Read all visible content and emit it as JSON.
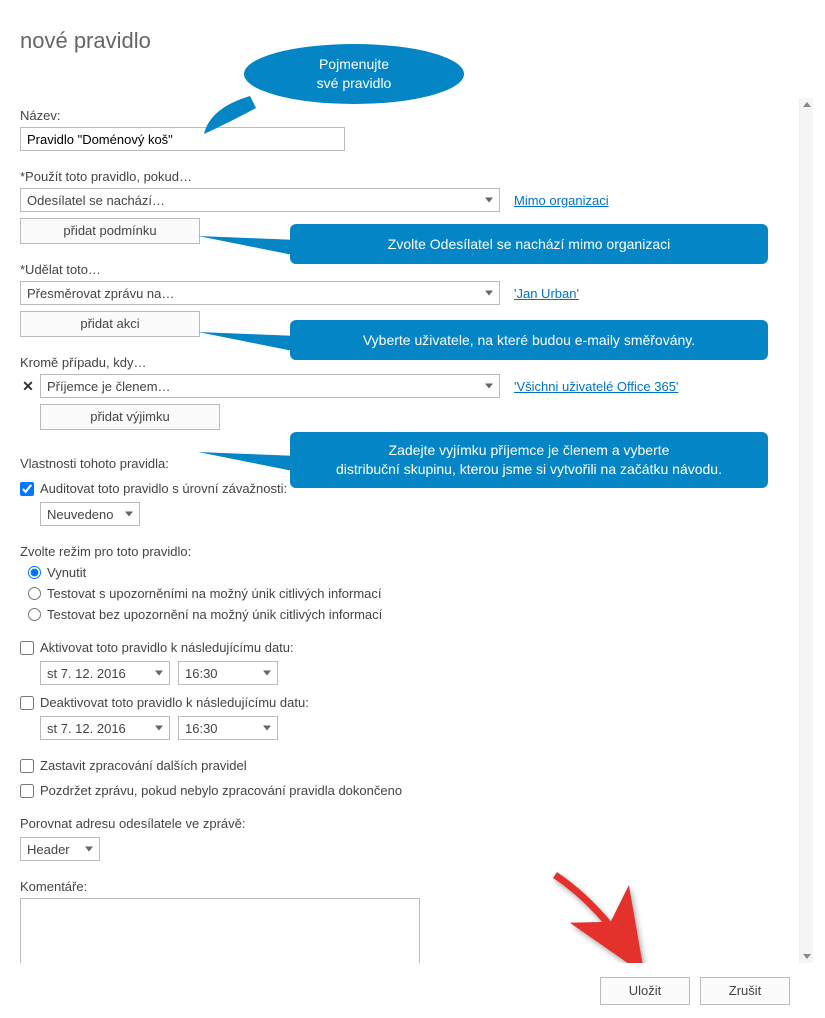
{
  "page": {
    "title": "nové pravidlo"
  },
  "callouts": {
    "c1a": "Pojmenujte",
    "c1b": "své pravidlo",
    "c2": "Zvolte Odesílatel se nachází mimo organizaci",
    "c3": "Vyberte uživatele, na které budou e-maily směřovány.",
    "c4a": "Zadejte vyjímku příjemce je členem a vyberte",
    "c4b": "distribuční skupinu, kterou jsme si vytvořili na začátku návodu."
  },
  "name": {
    "label": "Název:",
    "value": "Pravidlo \"Doménový koš\""
  },
  "condition": {
    "label": "*Použít toto pravidlo, pokud…",
    "value": "Odesílatel se nachází…",
    "link": "Mimo organizaci",
    "add": "přidat podmínku"
  },
  "action": {
    "label": "*Udělat toto…",
    "value": "Přesměrovat zprávu na…",
    "link": "'Jan Urban'",
    "add": "přidat akci"
  },
  "exception": {
    "label": "Kromě případu, kdy…",
    "value": "Příjemce je členem…",
    "link": "'Všichni uživatelé Office 365'",
    "add": "přidat výjimku",
    "remove": "✕"
  },
  "properties": {
    "heading": "Vlastnosti tohoto pravidla:",
    "audit_label": "Auditovat toto pravidlo s úrovní závažnosti:",
    "audit_value": "Neuvedeno"
  },
  "mode": {
    "heading": "Zvolte režim pro toto pravidlo:",
    "opt1": "Vynutit",
    "opt2": "Testovat s upozorněními na možný únik citlivých informací",
    "opt3": "Testovat bez upozornění na možný únik citlivých informací"
  },
  "activate": {
    "label": "Aktivovat toto pravidlo k následujícímu datu:",
    "date": "st 7. 12. 2016",
    "time": "16:30"
  },
  "deactivate": {
    "label": "Deaktivovat toto pravidlo k následujícímu datu:",
    "date": "st 7. 12. 2016",
    "time": "16:30"
  },
  "stop": {
    "label": "Zastavit zpracování dalších pravidel"
  },
  "defer": {
    "label": "Pozdržet zprávu, pokud nebylo zpracování pravidla dokončeno"
  },
  "match": {
    "label": "Porovnat adresu odesílatele ve zprávě:",
    "value": "Header"
  },
  "comments": {
    "label": "Komentáře:"
  },
  "footer": {
    "save": "Uložit",
    "cancel": "Zrušit"
  }
}
